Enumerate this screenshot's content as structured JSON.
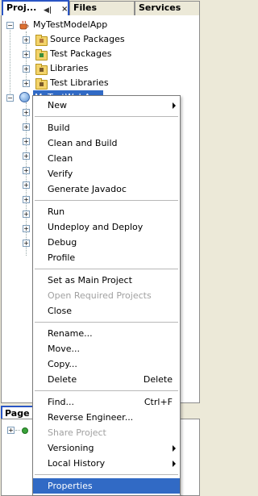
{
  "tabs": {
    "projects": "Proj...",
    "files": "Files",
    "services": "Services"
  },
  "tree": {
    "model_app": "MyTestModelApp",
    "source_packages": "Source Packages",
    "test_packages": "Test Packages",
    "libraries": "Libraries",
    "test_libraries": "Test Libraries",
    "web_app": "MyTestWebApp"
  },
  "navigator": {
    "tab": "Page"
  },
  "menu": {
    "new": "New",
    "build": "Build",
    "clean_build": "Clean and Build",
    "clean": "Clean",
    "verify": "Verify",
    "javadoc": "Generate Javadoc",
    "run": "Run",
    "undeploy": "Undeploy and Deploy",
    "debug": "Debug",
    "profile": "Profile",
    "set_main": "Set as Main Project",
    "open_required": "Open Required Projects",
    "close": "Close",
    "rename": "Rename...",
    "move": "Move...",
    "copy": "Copy...",
    "delete": "Delete",
    "delete_shortcut": "Delete",
    "find": "Find...",
    "find_shortcut": "Ctrl+F",
    "reverse": "Reverse Engineer...",
    "share": "Share Project",
    "versioning": "Versioning",
    "history": "Local History",
    "properties": "Properties"
  },
  "colors": {
    "selection": "#316ac5",
    "active_tab_border": "#2a55c4",
    "disabled_text": "#a0a0a0"
  }
}
